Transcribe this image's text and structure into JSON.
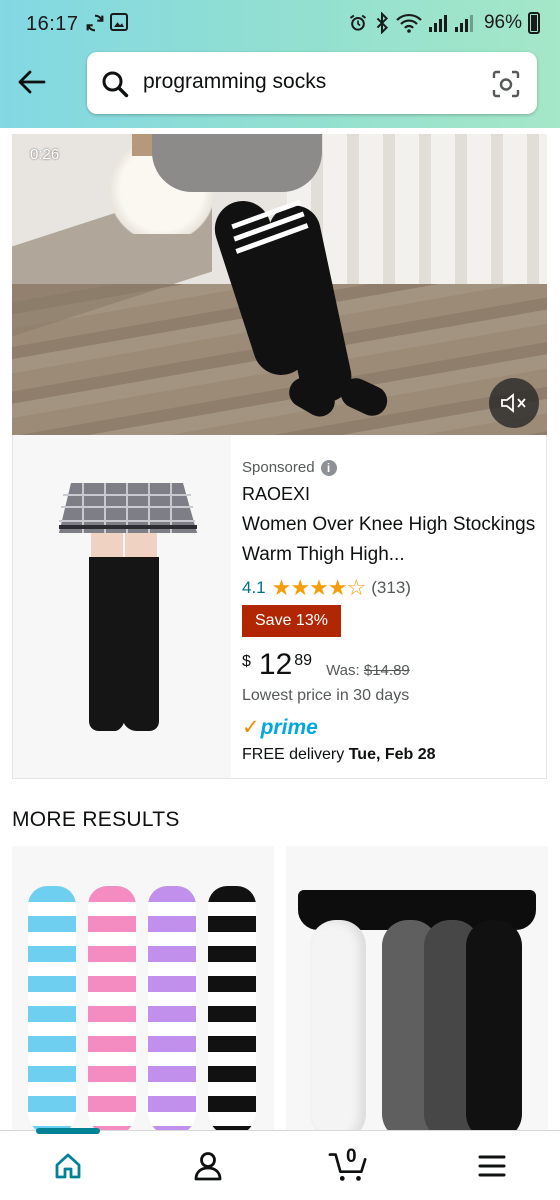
{
  "status_bar": {
    "time": "16:17",
    "battery_pct": "96%"
  },
  "search": {
    "query": "programming socks"
  },
  "video": {
    "timer": "0:26"
  },
  "sponsored_product": {
    "sponsored_label": "Sponsored",
    "brand": "RAOEXI",
    "title": "Women Over Knee High Stockings Warm Thigh High...",
    "rating_value": "4.1",
    "rating_stars": 4.1,
    "stars_glyphs": "★★★★☆",
    "review_count": "(313)",
    "discount_badge": "Save 13%",
    "price_currency": "$",
    "price_whole": "12",
    "price_fraction": "89",
    "was_label": "Was:",
    "was_price": "$14.89",
    "lowest_price_note": "Lowest price in 30 days",
    "prime_label": "prime",
    "delivery_prefix": "FREE delivery",
    "delivery_date": "Tue, Feb 28"
  },
  "more_results": {
    "heading": "MORE RESULTS"
  },
  "bottom_nav": {
    "items": [
      "home-icon",
      "account-icon",
      "cart-icon",
      "menu-icon"
    ],
    "cart_count": "0",
    "active_color": "#008296"
  },
  "colors": {
    "header_gradient_start": "#82d8e3",
    "header_gradient_end": "#a5e7c8",
    "discount_badge": "#b12704",
    "rating_link": "#007185",
    "star": "#f59e0b",
    "prime_blue": "#00a8e1"
  }
}
